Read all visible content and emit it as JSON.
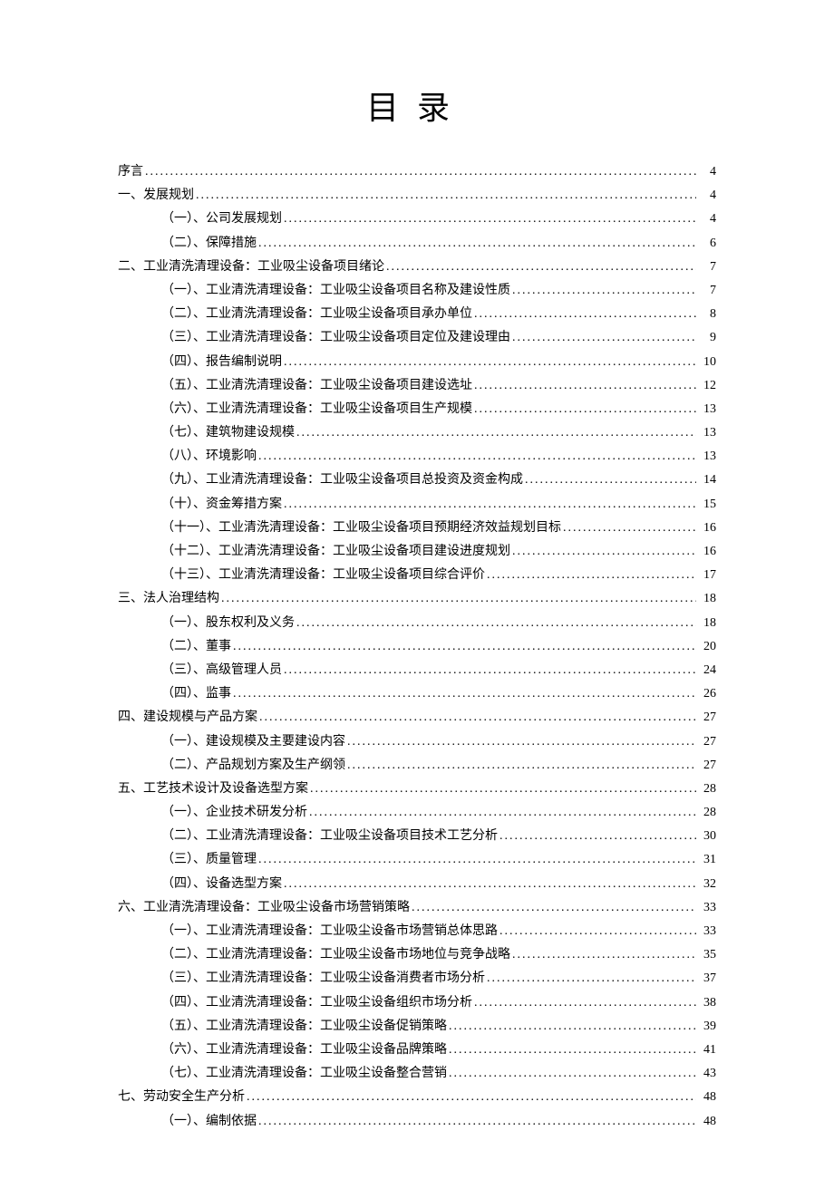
{
  "title": "目录",
  "entries": [
    {
      "level": 1,
      "label": "序言",
      "page": "4"
    },
    {
      "level": 1,
      "label": "一、发展规划",
      "page": "4"
    },
    {
      "level": 2,
      "label": "（一）、公司发展规划",
      "page": "4"
    },
    {
      "level": 2,
      "label": "（二）、保障措施",
      "page": "6"
    },
    {
      "level": 1,
      "label": "二、工业清洗清理设备：工业吸尘设备项目绪论",
      "page": "7"
    },
    {
      "level": 2,
      "label": "（一）、工业清洗清理设备：工业吸尘设备项目名称及建设性质",
      "page": "7"
    },
    {
      "level": 2,
      "label": "（二）、工业清洗清理设备：工业吸尘设备项目承办单位",
      "page": "8"
    },
    {
      "level": 2,
      "label": "（三）、工业清洗清理设备：工业吸尘设备项目定位及建设理由",
      "page": "9"
    },
    {
      "level": 2,
      "label": "（四）、报告编制说明",
      "page": "10"
    },
    {
      "level": 2,
      "label": "（五）、工业清洗清理设备：工业吸尘设备项目建设选址",
      "page": "12"
    },
    {
      "level": 2,
      "label": "（六）、工业清洗清理设备：工业吸尘设备项目生产规模",
      "page": "13"
    },
    {
      "level": 2,
      "label": "（七）、建筑物建设规模",
      "page": "13"
    },
    {
      "level": 2,
      "label": "（八）、环境影响",
      "page": "13"
    },
    {
      "level": 2,
      "label": "（九）、工业清洗清理设备：工业吸尘设备项目总投资及资金构成",
      "page": "14"
    },
    {
      "level": 2,
      "label": "（十）、资金筹措方案",
      "page": "15"
    },
    {
      "level": 2,
      "label": "（十一）、工业清洗清理设备：工业吸尘设备项目预期经济效益规划目标",
      "page": "16"
    },
    {
      "level": 2,
      "label": "（十二）、工业清洗清理设备：工业吸尘设备项目建设进度规划",
      "page": "16"
    },
    {
      "level": 2,
      "label": "（十三）、工业清洗清理设备：工业吸尘设备项目综合评价",
      "page": "17"
    },
    {
      "level": 1,
      "label": "三、法人治理结构",
      "page": "18"
    },
    {
      "level": 2,
      "label": "（一）、股东权利及义务",
      "page": "18"
    },
    {
      "level": 2,
      "label": "（二）、董事",
      "page": "20"
    },
    {
      "level": 2,
      "label": "（三）、高级管理人员",
      "page": "24"
    },
    {
      "level": 2,
      "label": "（四）、监事",
      "page": "26"
    },
    {
      "level": 1,
      "label": "四、建设规模与产品方案",
      "page": "27"
    },
    {
      "level": 2,
      "label": "（一）、建设规模及主要建设内容",
      "page": "27"
    },
    {
      "level": 2,
      "label": "（二）、产品规划方案及生产纲领",
      "page": "27"
    },
    {
      "level": 1,
      "label": "五、工艺技术设计及设备选型方案",
      "page": "28"
    },
    {
      "level": 2,
      "label": "（一）、企业技术研发分析",
      "page": "28"
    },
    {
      "level": 2,
      "label": "（二）、工业清洗清理设备：工业吸尘设备项目技术工艺分析",
      "page": "30"
    },
    {
      "level": 2,
      "label": "（三）、质量管理",
      "page": "31"
    },
    {
      "level": 2,
      "label": "（四）、设备选型方案",
      "page": "32"
    },
    {
      "level": 1,
      "label": "六、工业清洗清理设备：工业吸尘设备市场营销策略",
      "page": "33"
    },
    {
      "level": 2,
      "label": "（一）、工业清洗清理设备：工业吸尘设备市场营销总体思路",
      "page": "33"
    },
    {
      "level": 2,
      "label": "（二）、工业清洗清理设备：工业吸尘设备市场地位与竞争战略",
      "page": "35"
    },
    {
      "level": 2,
      "label": "（三）、工业清洗清理设备：工业吸尘设备消费者市场分析",
      "page": "37"
    },
    {
      "level": 2,
      "label": "（四）、工业清洗清理设备：工业吸尘设备组织市场分析",
      "page": "38"
    },
    {
      "level": 2,
      "label": "（五）、工业清洗清理设备：工业吸尘设备促销策略",
      "page": "39"
    },
    {
      "level": 2,
      "label": "（六）、工业清洗清理设备：工业吸尘设备品牌策略",
      "page": "41"
    },
    {
      "level": 2,
      "label": "（七）、工业清洗清理设备：工业吸尘设备整合营销",
      "page": "43"
    },
    {
      "level": 1,
      "label": "七、劳动安全生产分析",
      "page": "48"
    },
    {
      "level": 2,
      "label": "（一）、编制依据",
      "page": "48"
    }
  ]
}
